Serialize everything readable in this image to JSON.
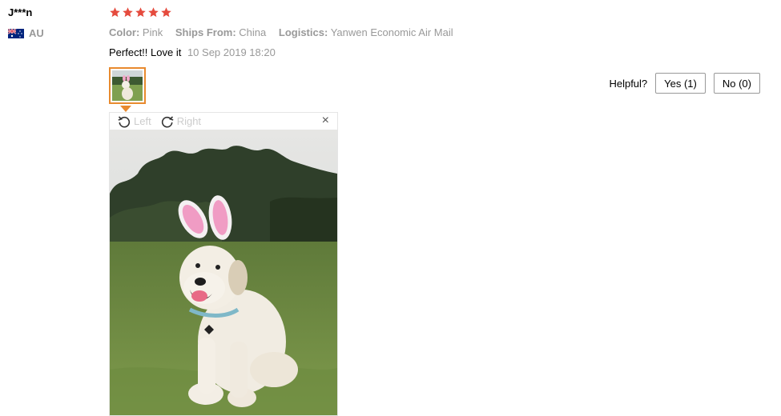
{
  "reviewer": {
    "name": "J***n",
    "country_code": "AU"
  },
  "rating": {
    "stars": 5,
    "max": 5,
    "color": "#e54b3e"
  },
  "meta": {
    "color_key": "Color:",
    "color_val": "Pink",
    "ships_key": "Ships From:",
    "ships_val": "China",
    "logistics_key": "Logistics:",
    "logistics_val": "Yanwen Economic Air Mail"
  },
  "review": {
    "text": "Perfect!! Love it",
    "date": "10 Sep 2019 18:20"
  },
  "helpful": {
    "label": "Helpful?",
    "yes": "Yes (1)",
    "no": "No (0)"
  },
  "viewer": {
    "rotate_left": "Left",
    "rotate_right": "Right",
    "close_glyph": "×"
  },
  "colors": {
    "accent": "#e88a2e",
    "muted": "#999999"
  }
}
